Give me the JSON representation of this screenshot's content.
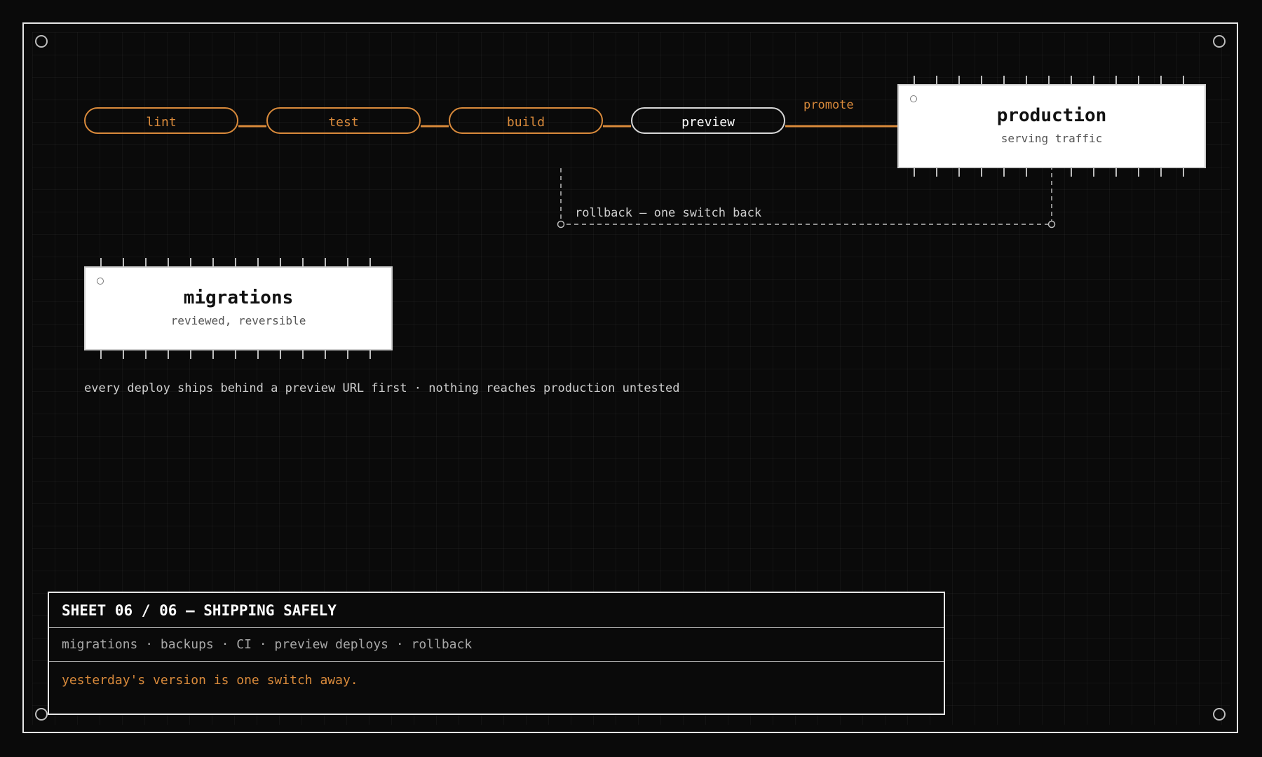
{
  "pipeline": {
    "stages": [
      {
        "label": "lint"
      },
      {
        "label": "test"
      },
      {
        "label": "build"
      },
      {
        "label": "preview"
      }
    ],
    "promote_label": "promote",
    "rollback_label": "rollback — one switch back"
  },
  "production": {
    "title": "production",
    "subtitle": "serving traffic"
  },
  "migrations": {
    "title": "migrations",
    "subtitle": "reviewed, reversible"
  },
  "caption": "every deploy ships behind a preview URL first · nothing reaches production untested",
  "sheet": {
    "title": "SHEET 06 / 06 — SHIPPING SAFELY",
    "topics": "migrations · backups · CI · preview deploys · rollback",
    "tagline": "yesterday's version is one switch away."
  },
  "colors": {
    "accent": "#d98a3b",
    "background": "#0a0a0a",
    "chip": "#ffffff"
  }
}
